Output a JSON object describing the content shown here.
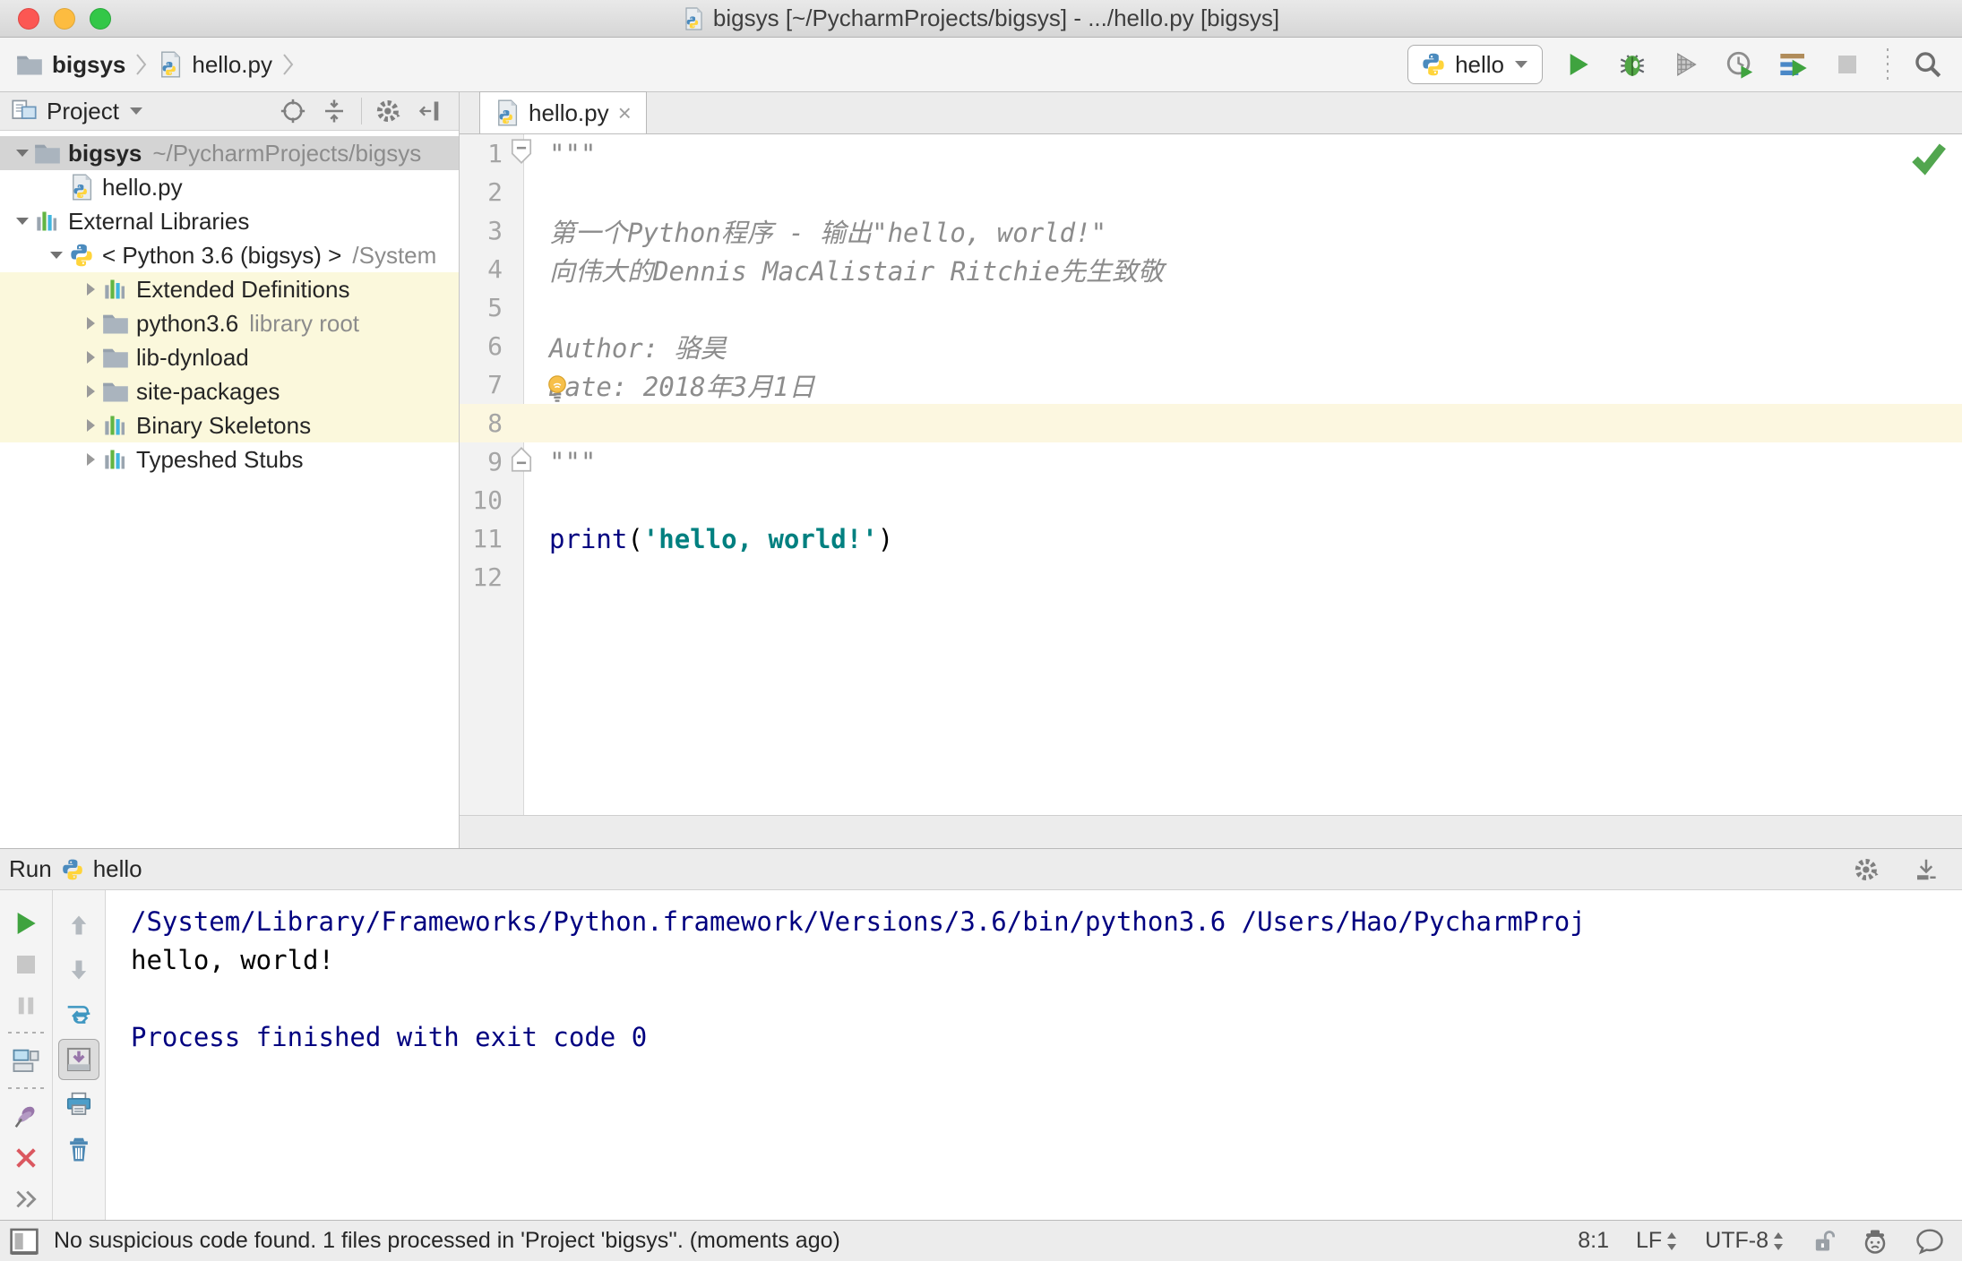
{
  "titlebar": {
    "title": "bigsys [~/PycharmProjects/bigsys] - .../hello.py [bigsys]"
  },
  "navbar": {
    "breadcrumbs": [
      {
        "icon": "folder",
        "label": "bigsys",
        "bold": true
      },
      {
        "icon": "pyfile",
        "label": "hello.py",
        "bold": false
      }
    ],
    "run_config": "hello"
  },
  "project_panel": {
    "title": "Project",
    "tree": [
      {
        "level": 0,
        "expander": "open",
        "icon": "folder",
        "label": "bigsys",
        "bold": true,
        "suffix": "~/PycharmProjects/bigsys",
        "bg": "sel"
      },
      {
        "level": 1,
        "expander": "none",
        "icon": "pyfile",
        "label": "hello.py",
        "bold": false,
        "suffix": "",
        "bg": ""
      },
      {
        "level": 0,
        "expander": "open",
        "icon": "library",
        "label": "External Libraries",
        "bold": false,
        "suffix": "",
        "bg": ""
      },
      {
        "level": 1,
        "expander": "open",
        "icon": "python",
        "label": "< Python 3.6 (bigsys) >",
        "bold": false,
        "suffix": "/System",
        "bg": ""
      },
      {
        "level": 2,
        "expander": "closed",
        "icon": "library",
        "label": "Extended Definitions",
        "bold": false,
        "suffix": "",
        "bg": "hl"
      },
      {
        "level": 2,
        "expander": "closed",
        "icon": "folder",
        "label": "python3.6",
        "bold": false,
        "suffix": "library root",
        "bg": "hl"
      },
      {
        "level": 2,
        "expander": "closed",
        "icon": "folder",
        "label": "lib-dynload",
        "bold": false,
        "suffix": "",
        "bg": "hl"
      },
      {
        "level": 2,
        "expander": "closed",
        "icon": "folder",
        "label": "site-packages",
        "bold": false,
        "suffix": "",
        "bg": "hl"
      },
      {
        "level": 2,
        "expander": "closed",
        "icon": "library",
        "label": "Binary Skeletons",
        "bold": false,
        "suffix": "",
        "bg": "hl"
      },
      {
        "level": 2,
        "expander": "closed",
        "icon": "library",
        "label": "Typeshed Stubs",
        "bold": false,
        "suffix": "",
        "bg": ""
      }
    ]
  },
  "editor": {
    "tab": {
      "label": "hello.py",
      "close": "×"
    },
    "lines": [
      {
        "num": "1",
        "fold": "start",
        "caret": false,
        "bulb": false,
        "tokens": [
          {
            "t": "\"\"\"",
            "s": "doc"
          }
        ]
      },
      {
        "num": "2",
        "fold": "",
        "caret": false,
        "bulb": false,
        "tokens": []
      },
      {
        "num": "3",
        "fold": "",
        "caret": false,
        "bulb": false,
        "tokens": [
          {
            "t": "第一个Python程序 - 输出\"hello, world!\"",
            "s": "doc"
          }
        ]
      },
      {
        "num": "4",
        "fold": "",
        "caret": false,
        "bulb": false,
        "tokens": [
          {
            "t": "向伟大的Dennis MacAlistair Ritchie先生致敬",
            "s": "doc"
          }
        ]
      },
      {
        "num": "5",
        "fold": "",
        "caret": false,
        "bulb": false,
        "tokens": []
      },
      {
        "num": "6",
        "fold": "",
        "caret": false,
        "bulb": false,
        "tokens": [
          {
            "t": "Author: 骆昊",
            "s": "doc"
          }
        ]
      },
      {
        "num": "7",
        "fold": "",
        "caret": false,
        "bulb": true,
        "tokens": [
          {
            "t": "Date: 2018年3月1日",
            "s": "doc"
          }
        ]
      },
      {
        "num": "8",
        "fold": "",
        "caret": true,
        "bulb": false,
        "tokens": []
      },
      {
        "num": "9",
        "fold": "end",
        "caret": false,
        "bulb": false,
        "tokens": [
          {
            "t": "\"\"\"",
            "s": "doc"
          }
        ]
      },
      {
        "num": "10",
        "fold": "",
        "caret": false,
        "bulb": false,
        "tokens": []
      },
      {
        "num": "11",
        "fold": "",
        "caret": false,
        "bulb": false,
        "tokens": [
          {
            "t": "print",
            "s": "kw"
          },
          {
            "t": "(",
            "s": "plain"
          },
          {
            "t": "'hello, world!'",
            "s": "str"
          },
          {
            "t": ")",
            "s": "plain"
          }
        ]
      },
      {
        "num": "12",
        "fold": "",
        "caret": false,
        "bulb": false,
        "tokens": []
      }
    ]
  },
  "run_panel": {
    "title": "Run",
    "config": "hello",
    "console": [
      {
        "text": "/System/Library/Frameworks/Python.framework/Versions/3.6/bin/python3.6 /Users/Hao/PycharmProj",
        "style": "system"
      },
      {
        "text": "hello, world!",
        "style": "stdout"
      },
      {
        "text": " ",
        "style": "stdout"
      },
      {
        "text": "Process finished with exit code 0",
        "style": "system"
      }
    ]
  },
  "statusbar": {
    "message": "No suspicious code found. 1 files processed in 'Project 'bigsys''. (moments ago)",
    "caret_position": "8:1",
    "line_ending": "LF",
    "encoding": "UTF-8"
  },
  "colors": {
    "keyword": "#000080",
    "string": "#008080",
    "doc_comment": "#8c8c8c",
    "console_system": "#000080",
    "run_green": "#3fa33f",
    "caret_row": "#fcf7e0",
    "tree_highlight": "#fbf8dc",
    "selection_inactive": "#d4d4d4"
  }
}
